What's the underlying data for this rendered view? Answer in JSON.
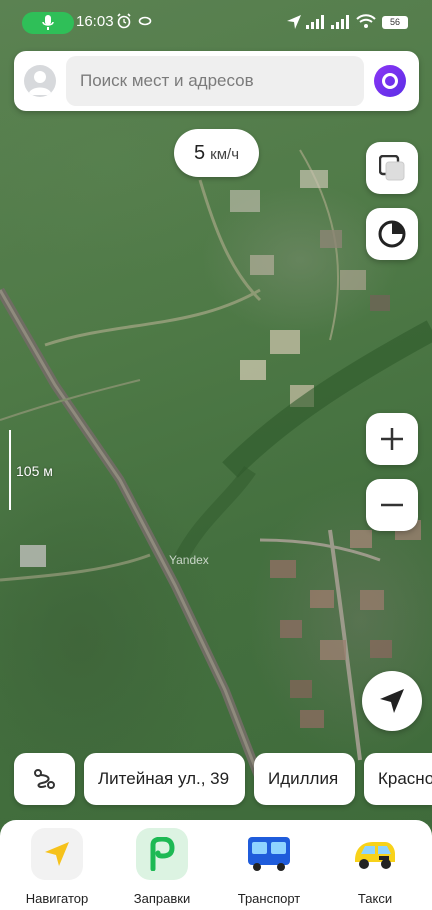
{
  "status_bar": {
    "time": "16:03",
    "battery": "56"
  },
  "search": {
    "placeholder": "Поиск мест и адресов"
  },
  "speed": {
    "value": "5",
    "unit": "км/ч"
  },
  "map": {
    "scale_label": "105 м",
    "watermark": "Yandex"
  },
  "chips": [
    {
      "label": "Литейная ул., 39"
    },
    {
      "label": "Идиллия"
    },
    {
      "label": "Красно"
    }
  ],
  "bottom_nav": {
    "items": [
      {
        "label": "Навигатор",
        "icon": "navigator-icon"
      },
      {
        "label": "Заправки",
        "icon": "fuel-icon"
      },
      {
        "label": "Транспорт",
        "icon": "bus-icon"
      },
      {
        "label": "Такси",
        "icon": "taxi-icon"
      }
    ]
  }
}
